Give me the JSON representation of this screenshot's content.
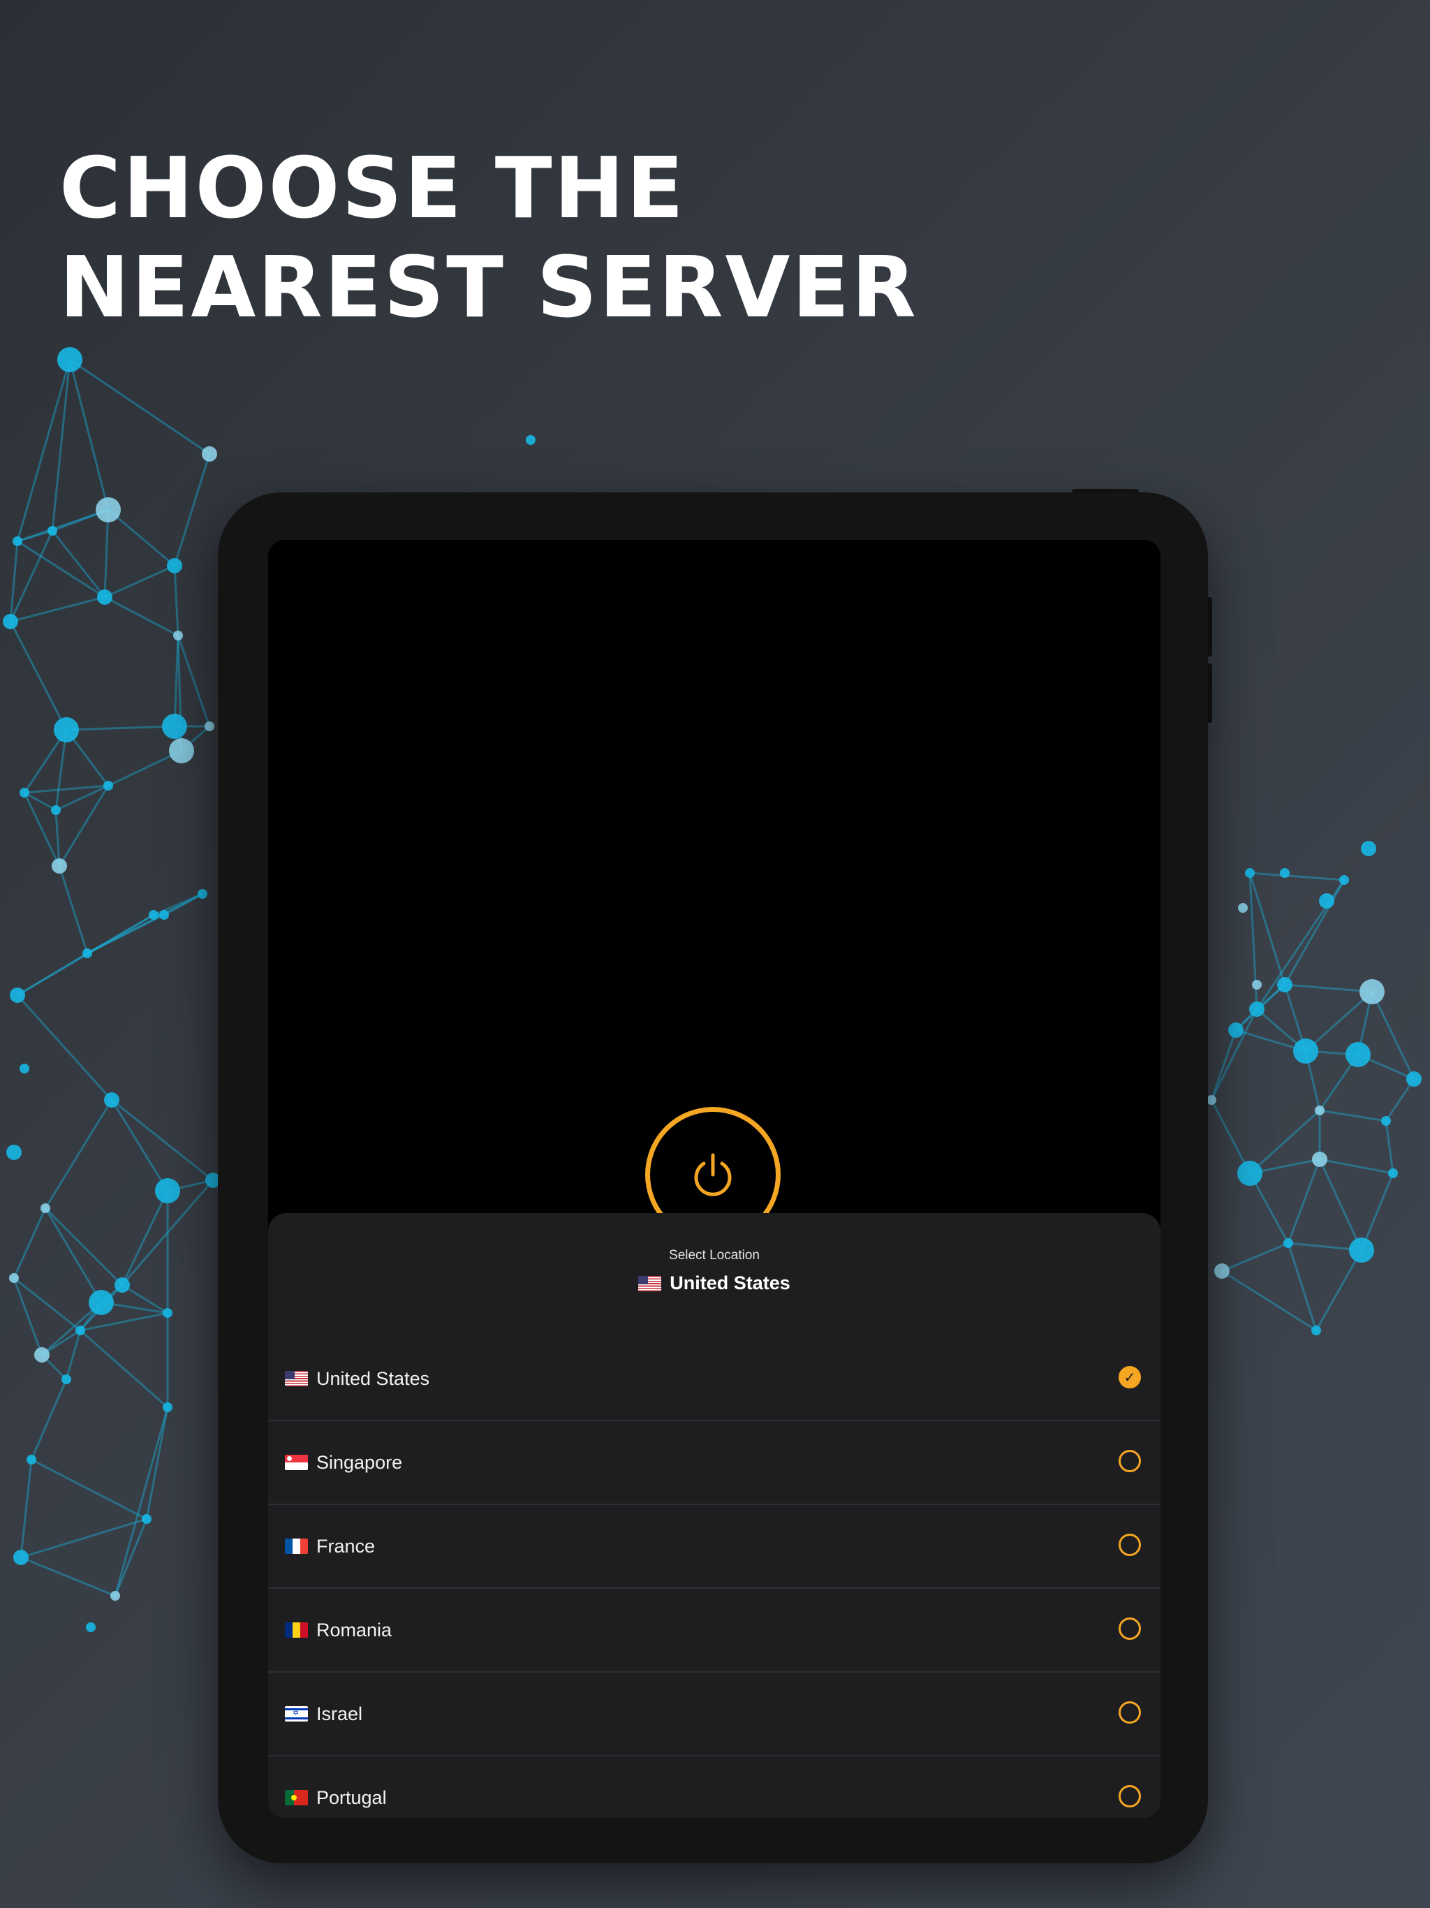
{
  "headline": {
    "line1": "CHOOSE THE",
    "line2": "NEAREST SERVER"
  },
  "colors": {
    "accent": "#f5a623",
    "network": "#17b8e6",
    "sheet": "#1e1e20"
  },
  "power_button": {
    "icon": "power-icon"
  },
  "location_sheet": {
    "caption": "Select Location",
    "selected": {
      "name": "United States",
      "flag": "flag-us"
    }
  },
  "locations": [
    {
      "name": "United States",
      "flag": "flag-us",
      "selected": true
    },
    {
      "name": "Singapore",
      "flag": "flag-sg",
      "selected": false
    },
    {
      "name": "France",
      "flag": "flag-fr",
      "selected": false
    },
    {
      "name": "Romania",
      "flag": "flag-ro",
      "selected": false
    },
    {
      "name": "Israel",
      "flag": "flag-il",
      "selected": false
    },
    {
      "name": "Portugal",
      "flag": "flag-pt",
      "selected": false
    }
  ]
}
